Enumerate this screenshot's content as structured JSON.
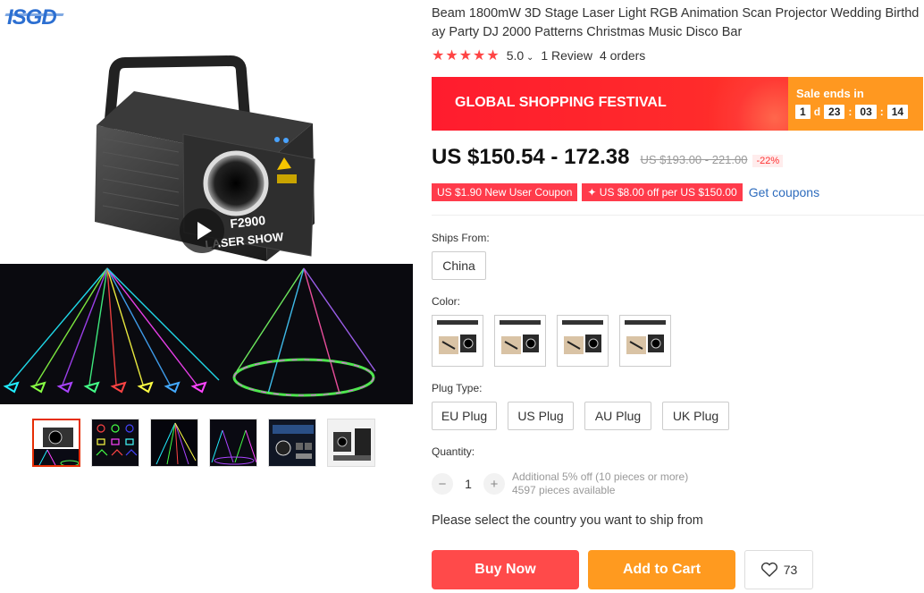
{
  "brand": {
    "logo_text": "ISGD"
  },
  "product": {
    "title": "Beam 1800mW 3D Stage Laser Light RGB Animation Scan Projector Wedding Birthday Party DJ 2000 Patterns Christmas Music Disco Bar",
    "stars": "★★★★★",
    "rating": "5.0",
    "reviews": "1 Review",
    "orders": "4 orders",
    "image_labels": {
      "model": "F2900",
      "caption": "LASER SHOW"
    }
  },
  "banner": {
    "festival": "GLOBAL SHOPPING FESTIVAL",
    "sale_ends": "Sale ends in",
    "days": "1",
    "days_unit": "d",
    "hours": "23",
    "minutes": "03",
    "seconds": "14",
    "sep": ":"
  },
  "price": {
    "current": "US $150.54 - 172.38",
    "original": "US $193.00 - 221.00",
    "discount": "-22%"
  },
  "coupons": {
    "new_user": "US $1.90 New User Coupon",
    "store": "✦ US $8.00 off per US $150.00",
    "get": "Get coupons"
  },
  "ships_from": {
    "label": "Ships From:",
    "value": "China"
  },
  "color": {
    "label": "Color:"
  },
  "plug": {
    "label": "Plug Type:",
    "options": [
      "EU Plug",
      "US Plug",
      "AU Plug",
      "UK Plug"
    ]
  },
  "quantity": {
    "label": "Quantity:",
    "minus": "−",
    "value": "1",
    "plus": "+",
    "bulk_note": "Additional 5% off (10 pieces or more)",
    "available": "4597 pieces available"
  },
  "ship_message": "Please select the country you want to ship from",
  "actions": {
    "buy_now": "Buy Now",
    "add_to_cart": "Add to Cart",
    "wishlist_count": "73"
  },
  "colors": {
    "red": "#ff4a4a",
    "orange": "#ff9a1f",
    "accent_blue": "#2e6cbd"
  }
}
